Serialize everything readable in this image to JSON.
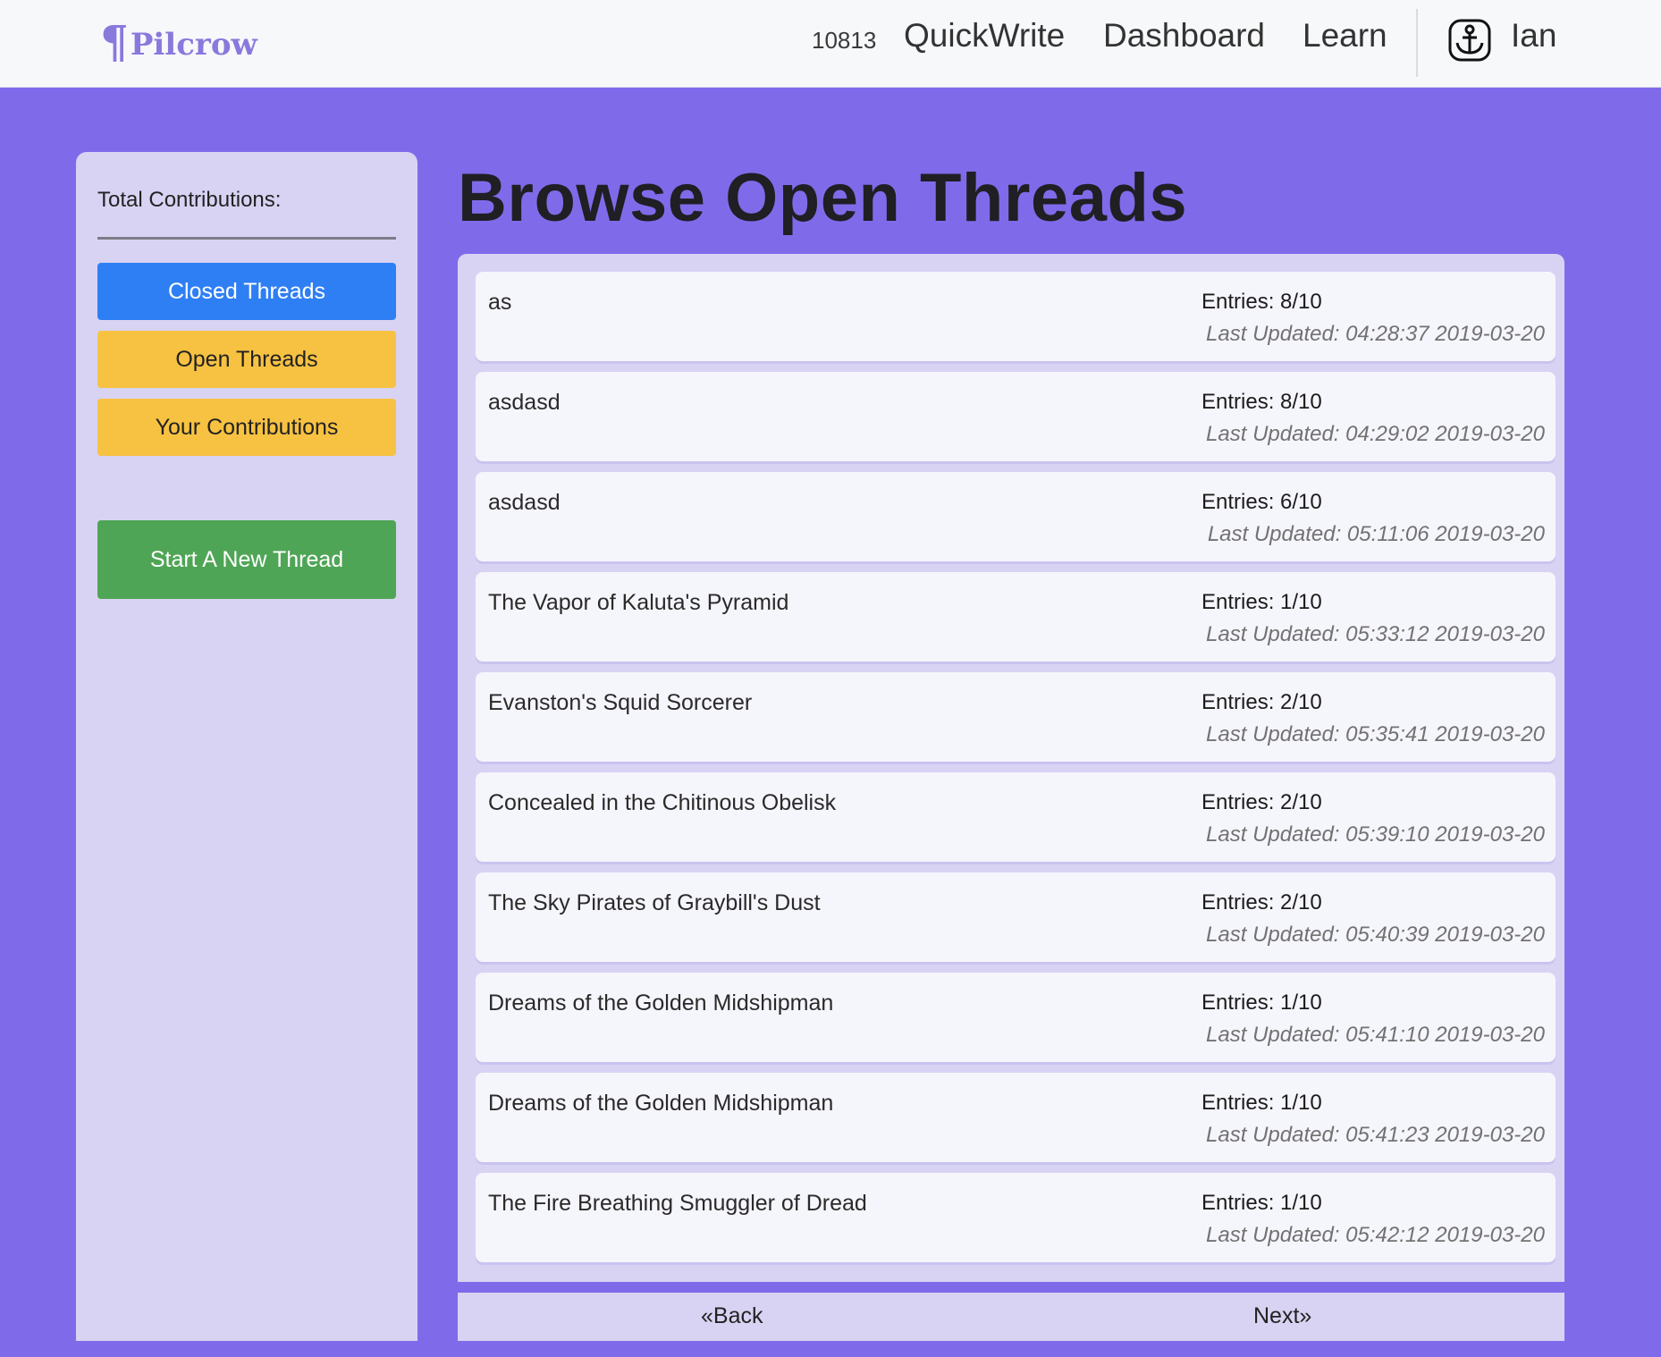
{
  "header": {
    "logo_mark": "¶",
    "logo_text": "Pilcrow",
    "count": "10813",
    "nav": [
      "QuickWrite",
      "Dashboard",
      "Learn"
    ],
    "user_icon": "anchor-icon",
    "user_name": "Ian"
  },
  "sidebar": {
    "contributions_label": "Total Contributions:",
    "closed_threads": "Closed Threads",
    "open_threads": "Open Threads",
    "your_contributions": "Your Contributions",
    "start_new_thread": "Start A New Thread"
  },
  "main": {
    "title": "Browse Open Threads",
    "threads": [
      {
        "title": "as",
        "entries": "Entries: 8/10",
        "updated": "Last Updated: 04:28:37 2019-03-20"
      },
      {
        "title": "asdasd",
        "entries": "Entries: 8/10",
        "updated": "Last Updated: 04:29:02 2019-03-20"
      },
      {
        "title": "asdasd",
        "entries": "Entries: 6/10",
        "updated": "Last Updated: 05:11:06 2019-03-20"
      },
      {
        "title": "The Vapor of Kaluta's Pyramid",
        "entries": "Entries: 1/10",
        "updated": "Last Updated: 05:33:12 2019-03-20"
      },
      {
        "title": "Evanston's Squid Sorcerer",
        "entries": "Entries: 2/10",
        "updated": "Last Updated: 05:35:41 2019-03-20"
      },
      {
        "title": "Concealed in the Chitinous Obelisk",
        "entries": "Entries: 2/10",
        "updated": "Last Updated: 05:39:10 2019-03-20"
      },
      {
        "title": "The Sky Pirates of Graybill's Dust",
        "entries": "Entries: 2/10",
        "updated": "Last Updated: 05:40:39 2019-03-20"
      },
      {
        "title": "Dreams of the Golden Midshipman",
        "entries": "Entries: 1/10",
        "updated": "Last Updated: 05:41:10 2019-03-20"
      },
      {
        "title": "Dreams of the Golden Midshipman",
        "entries": "Entries: 1/10",
        "updated": "Last Updated: 05:41:23 2019-03-20"
      },
      {
        "title": "The Fire Breathing Smuggler of Dread",
        "entries": "Entries: 1/10",
        "updated": "Last Updated: 05:42:12 2019-03-20"
      }
    ]
  },
  "pager": {
    "back": "«Back",
    "next": "Next»"
  },
  "colors": {
    "background": "#7f6bea",
    "panel": "#d8d3f3",
    "closed_btn": "#2f7ff4",
    "open_btn": "#f7c242",
    "new_thread_btn": "#4fa556"
  }
}
